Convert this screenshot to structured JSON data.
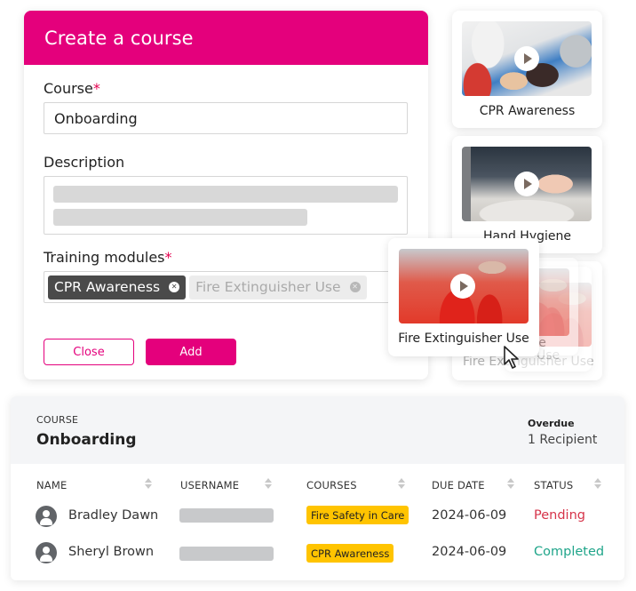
{
  "create_course": {
    "title": "Create a course",
    "course_label": "Course",
    "required_mark": "*",
    "course_value": "Onboarding",
    "description_label": "Description",
    "modules_label": "Training modules",
    "modules": [
      {
        "label": "CPR Awareness",
        "state": "selected",
        "remove_icon": "close-circle-icon"
      },
      {
        "label": "Fire Extinguisher Use",
        "state": "pending",
        "remove_icon": "close-circle-icon"
      }
    ],
    "close_label": "Close",
    "add_label": "Add",
    "accent_color": "#e4007c"
  },
  "video_cards": [
    {
      "title": "CPR Awareness",
      "icon": "play-icon"
    },
    {
      "title": "Hand Hygiene",
      "icon": "play-icon"
    },
    {
      "title": "Fire Extinguisher Use",
      "icon": "play-icon",
      "state": "dragging"
    }
  ],
  "ghost_labels": [
    "se",
    "Use",
    "Fire Extinguisher Use"
  ],
  "table": {
    "course_caption": "COURSE",
    "course_name": "Onboarding",
    "overdue_caption": "Overdue",
    "overdue_value": "1 Recipient",
    "columns": [
      "NAME",
      "USERNAME",
      "COURSES",
      "DUE DATE",
      "STATUS"
    ],
    "rows": [
      {
        "name": "Bradley Dawn",
        "course": "Fire Safety in Care",
        "due_date": "2024-06-09",
        "status": "Pending"
      },
      {
        "name": "Sheryl Brown",
        "course": "CPR Awareness",
        "due_date": "2024-06-09",
        "status": "Completed"
      }
    ],
    "colors": {
      "pending": "#d6344a",
      "completed": "#20a58a",
      "badge": "#ffc400"
    }
  }
}
